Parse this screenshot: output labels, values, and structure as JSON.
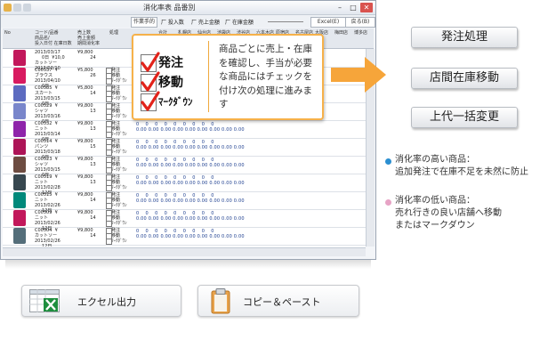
{
  "window": {
    "title": "消化率表 品番別",
    "buttons": {
      "minimize": "–",
      "maximize": "□",
      "close": "✕"
    }
  },
  "toolbar": {
    "order_proc": "作業手的",
    "check1": "厂 投入数",
    "check2": "厂 売上金額",
    "check3": "厂 在庫金額",
    "excel": "Excel(E)",
    "back": "戻る(B)"
  },
  "grid": {
    "header_left": [
      "No",
      "コード/品番\n商品名/\n投入日付 在庫日数",
      "売上数\n売上金額\n期間消化率",
      "処理"
    ],
    "header_right": [
      "合計",
      "札幌店",
      "仙台店",
      "池袋店",
      "渋谷店",
      "六本木店",
      "原宿店",
      "名古屋店",
      "大阪店",
      "梅田店",
      "博多店"
    ],
    "rows": [
      {
        "code": "2013/03/17\n     0日  ¥10,0\nカットソー\n2013/03/10",
        "price": "¥9,800\n         24",
        "act": "",
        "nums": "2\n0.00",
        "color": "#c2185b"
      },
      {
        "code": "C00537  ¥\nブラウス\n2013/04/10\n     0日",
        "price": "¥5,800\n         26",
        "act": "発注\n移動\nﾏｰｸﾀﾞｳﾝ",
        "nums": "0    0    0    0    0    0    0    0    0\n0.00 0.00 0.00 0.00 0.00 0.00 0.00 0.00 0.00",
        "color": "#d81b60"
      },
      {
        "code": "C00585  ¥\nスカート\n2013/03/15\n     0日",
        "price": "¥5,800\n         14",
        "act": "発注\n移動\nﾏｰｸﾀﾞｳﾝ",
        "nums": "0    0    0    0    0    0    0    0    0\n0.00 0.00 0.00 0.00 0.00 0.00 0.00 0.00 0.00",
        "color": "#5c6bc0"
      },
      {
        "code": "C00529  ¥\nシャツ\n2013/03/16\n     0日",
        "price": "¥9,800\n         13",
        "act": "発注\n移動\nﾏｰｸﾀﾞｳﾝ",
        "nums": "0    0    0    0    0    0    0    0    0\n0.00 0.00 0.00 0.00 0.00 0.00 0.00 0.00 0.00",
        "color": "#7986cb"
      },
      {
        "code": "C00532  ¥\nニット\n2013/03/14\n     0日",
        "price": "¥9,800\n         13",
        "act": "発注\n移動\nﾏｰｸﾀﾞｳﾝ",
        "nums": "0    0    0    0    0    0    0    0    0\n0.00 0.00 0.00 0.00 0.00 0.00 0.00 0.00 0.00",
        "color": "#8e24aa"
      },
      {
        "code": "C00514  ¥\nパンツ\n2013/03/18\n     0日",
        "price": "¥9,800\n         15",
        "act": "発注\n移動\nﾏｰｸﾀﾞｳﾝ",
        "nums": "0    0    0    0    0    0    0    0    0\n0.00 0.00 0.00 0.00 0.00 0.00 0.00 0.00 0.00",
        "color": "#ad1457"
      },
      {
        "code": "C00523  ¥\nシャツ\n2013/03/15\n     0日",
        "price": "¥9,800\n         13",
        "act": "発注\n移動\nﾏｰｸﾀﾞｳﾝ",
        "nums": "0    0    0    0    0    0    0    0    0\n0.00 0.00 0.00 0.00 0.00 0.00 0.00 0.00 0.00",
        "color": "#6d4c41"
      },
      {
        "code": "C00519  ¥\nニット\n2013/02/28\n     12日",
        "price": "¥9,800\n         13",
        "act": "発注\n移動\nﾏｰｸﾀﾞｳﾝ",
        "nums": "0    0    0    0    0    0    0    0    0\n0.00 0.00 0.00 0.00 0.00 0.00 0.00 0.00 0.00",
        "color": "#37474f"
      },
      {
        "code": "C00515  ¥\nニット\n2013/02/26\n     12日",
        "price": "¥9,800\n         14",
        "act": "発注\n移動\nﾏｰｸﾀﾞｳﾝ",
        "nums": "0    0    0    0    0    0    0    0    0\n0.00 0.00 0.00 0.00 0.00 0.00 0.00 0.00 0.00",
        "color": "#00897b"
      },
      {
        "code": "C00509  ¥\nニット\n2013/02/26\n     12日",
        "price": "¥9,800\n         14",
        "act": "発注\n移動\nﾏｰｸﾀﾞｳﾝ",
        "nums": "0    0    0    0    0    0    0    0    0\n0.00 0.00 0.00 0.00 0.00 0.00 0.00 0.00 0.00",
        "color": "#c2185b"
      },
      {
        "code": "C00504  ¥\nカットソー\n2013/02/26\n     12日",
        "price": "¥9,800\n         14",
        "act": "発注\n移動\nﾏｰｸﾀﾞｳﾝ",
        "nums": "0    0    0    0    0    0    0    0    0\n0.00 0.00 0.00 0.00 0.00 0.00 0.00 0.00 0.00",
        "color": "#546e7a"
      }
    ]
  },
  "callout": {
    "items": [
      "発注",
      "移動",
      "ﾏｰｸﾀﾞｳﾝ"
    ],
    "description": "商品ごとに売上・在庫を確認し、手当が必要な商品にはチェックを付け次の処理に進みます"
  },
  "actions": {
    "order": "発注処理",
    "transfer": "店間在庫移動",
    "price_change": "上代一括変更"
  },
  "notes": {
    "high": "消化率の高い商品：\n追加発注で在庫不足を未然に防止",
    "low": "消化率の低い商品：\n売れ行きの良い店舗へ移動\nまたはマークダウン",
    "high_color": "#2b8fd1",
    "low_color": "#e7a3c5"
  },
  "bottom": {
    "excel": "エクセル出力",
    "copy_paste": "コピー＆ペースト"
  },
  "colors": {
    "accent_orange": "#f6a53a",
    "excel_green": "#1e8e3e"
  }
}
